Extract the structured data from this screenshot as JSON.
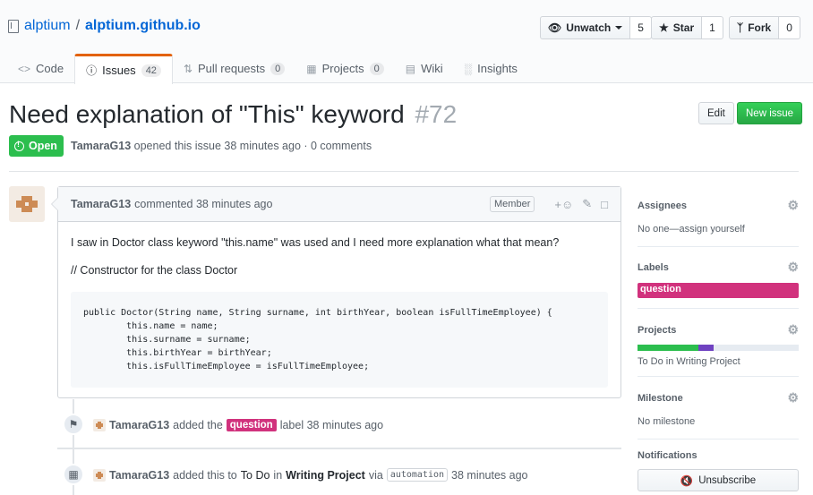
{
  "repo": {
    "owner": "alptium",
    "separator": "/",
    "name": "alptium.github.io"
  },
  "actions": {
    "watch": {
      "label": "Unwatch",
      "count": "5"
    },
    "star": {
      "label": "Star",
      "count": "1"
    },
    "fork": {
      "label": "Fork",
      "count": "0"
    }
  },
  "tabs": [
    {
      "label": "Code",
      "icon": "code-icon"
    },
    {
      "label": "Issues",
      "count": "42",
      "icon": "issue-icon"
    },
    {
      "label": "Pull requests",
      "count": "0",
      "icon": "pull-request-icon"
    },
    {
      "label": "Projects",
      "count": "0",
      "icon": "project-icon"
    },
    {
      "label": "Wiki",
      "icon": "book-icon"
    },
    {
      "label": "Insights",
      "icon": "graph-icon"
    }
  ],
  "issue": {
    "title": "Need explanation of \"This\" keyword",
    "number": "#72",
    "state": "Open",
    "author": "TamaraG13",
    "meta_rest": "opened this issue 38 minutes ago · 0 comments",
    "edit_label": "Edit",
    "new_label": "New issue"
  },
  "comment": {
    "author": "TamaraG13",
    "time": "commented 38 minutes ago",
    "badge": "Member",
    "paragraph1": "I saw in Doctor class keyword \"this.name\" was used and I need more explanation what that mean?",
    "paragraph2": "// Constructor for the class Doctor",
    "code": "public Doctor(String name, String surname, int birthYear, boolean isFullTimeEmployee) {\n        this.name = name;\n        this.surname = surname;\n        this.birthYear = birthYear;\n        this.isFullTimeEmployee = isFullTimeEmployee;"
  },
  "timeline": [
    {
      "author": "TamaraG13",
      "pre": "added the",
      "label": "question",
      "post": "label 38 minutes ago"
    },
    {
      "author": "TamaraG13",
      "pre": "added this to",
      "col": "To Do",
      "in": "in",
      "project": "Writing Project",
      "via": "via",
      "tag": "automation",
      "post": "38 minutes ago"
    }
  ],
  "sidebar": {
    "assignees": {
      "heading": "Assignees",
      "value": "No one—assign yourself"
    },
    "labels": {
      "heading": "Labels",
      "label": "question",
      "label_color": "#d1327d"
    },
    "projects": {
      "heading": "Projects",
      "value": "To Do in Writing Project",
      "progress_done": 0.38,
      "progress_inprogress": 0.09
    },
    "milestone": {
      "heading": "Milestone",
      "value": "No milestone"
    },
    "notifications": {
      "heading": "Notifications",
      "button": "Unsubscribe"
    }
  },
  "colors": {
    "accent": "#0366d6",
    "open": "#2cbe4e",
    "label": "#d1327d",
    "tab_active": "#e36209"
  }
}
